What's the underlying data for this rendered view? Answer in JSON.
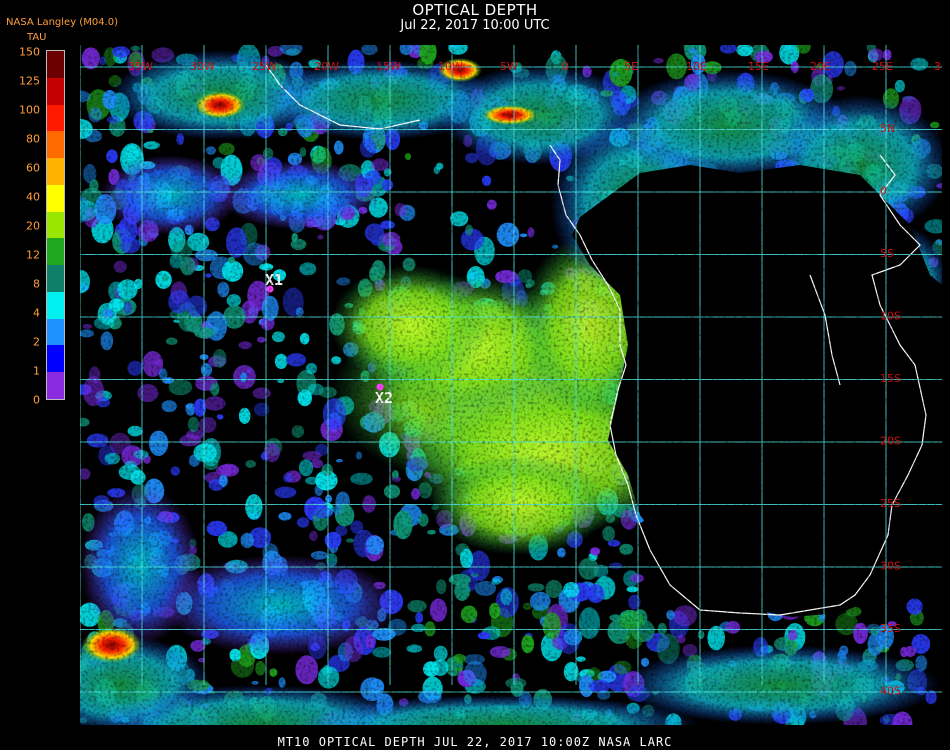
{
  "header": {
    "title": "OPTICAL DEPTH",
    "subtitle": "Jul 22, 2017 10:00 UTC",
    "product": "NASA Langley (M04.0)"
  },
  "legend": {
    "unit": "TAU",
    "ticks": [
      "150",
      "125",
      "100",
      "80",
      "60",
      "40",
      "20",
      "12",
      "8",
      "4",
      "2",
      "1",
      "0"
    ],
    "colors": [
      "#6b0000",
      "#c40000",
      "#ff1a00",
      "#ff6a00",
      "#ffb300",
      "#ffff00",
      "#99e600",
      "#1fa81f",
      "#0f7f6a",
      "#00f0f0",
      "#1e90ff",
      "#0000ff",
      "#8a2be2"
    ]
  },
  "map": {
    "top_lon_labels": [
      "35W",
      "30W",
      "25W",
      "20W",
      "15W",
      "10W",
      "5W",
      "0",
      "5E",
      "10E",
      "15E",
      "20E",
      "25E",
      "30E",
      "35E"
    ],
    "right_lat_labels": [
      "5N",
      "0",
      "5S",
      "10S",
      "15S",
      "20S",
      "25S",
      "30S",
      "35S",
      "40S"
    ],
    "markers": [
      {
        "label": "X1"
      },
      {
        "label": "X2"
      }
    ],
    "grid_color": "#4fe3e3",
    "coast_color": "#ffffff",
    "marker_color": "#ff40ff"
  },
  "footer": {
    "text": "MT10   OPTICAL DEPTH    JUL 22, 2017 10:00Z    NASA LARC"
  }
}
